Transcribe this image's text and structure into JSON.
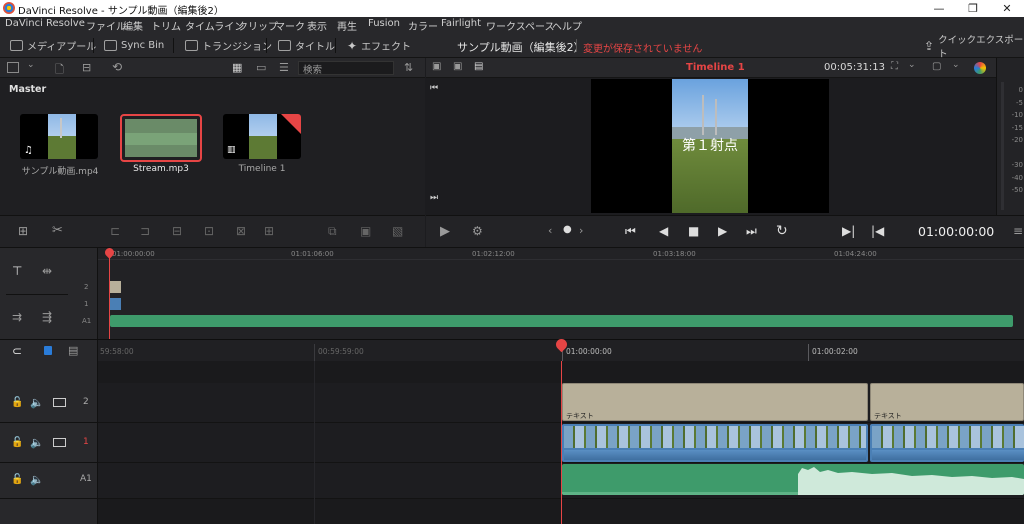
{
  "window": {
    "title": "DaVinci Resolve - サンプル動画（編集後2）",
    "minimize_glyph": "—",
    "maximize_glyph": "❐",
    "close_glyph": "✕"
  },
  "menu": [
    "DaVinci Resolve",
    "ファイル",
    "編集",
    "トリム",
    "タイムライン",
    "クリップ",
    "マーク",
    "表示",
    "再生",
    "Fusion",
    "カラー",
    "Fairlight",
    "ワークスペース",
    "ヘルプ"
  ],
  "toolbar": {
    "media_pool": "メディアプール",
    "sync_bin": "Sync Bin",
    "transitions": "トランジション",
    "titles": "タイトル",
    "effects": "エフェクト",
    "project_name": "サンプル動画（編集後2）",
    "unsaved_status": "変更が保存されていません",
    "quick_export": "クイックエクスポート"
  },
  "media_pool": {
    "search_placeholder": "検索",
    "bin_name": "Master",
    "clips": [
      {
        "name": "サンプル動画.mp4"
      },
      {
        "name": "Stream.mp3"
      },
      {
        "name": "Timeline 1"
      }
    ]
  },
  "viewer": {
    "timeline_name": "Timeline 1",
    "duration": "00:05:31:13",
    "overlay_text": "第１射点",
    "timecode": "01:00:00:00"
  },
  "meter": {
    "scale": [
      "0",
      "-5",
      "-10",
      "-15",
      "-20",
      "-30",
      "-40",
      "-50"
    ]
  },
  "overview": {
    "ticks": [
      "01:00:00:00",
      "01:01:06:00",
      "01:02:12:00",
      "01:03:18:00",
      "01:04:24:00"
    ],
    "tracks": [
      "2",
      "1",
      "A1"
    ]
  },
  "timeline": {
    "ticks": [
      "59:58:00",
      "00:59:59:00",
      "01:00:00:00",
      "01:00:02:00"
    ],
    "tracks": [
      {
        "label": "2"
      },
      {
        "label": "1"
      },
      {
        "label": "A1"
      }
    ],
    "title_clip_labels": [
      "テキスト",
      "テキスト"
    ]
  },
  "colors": {
    "accent_red": "#e64545",
    "audio_green": "#3e9b6b",
    "title_clip": "#b8b09a",
    "video_clip_bar": "#4a7fb5"
  }
}
